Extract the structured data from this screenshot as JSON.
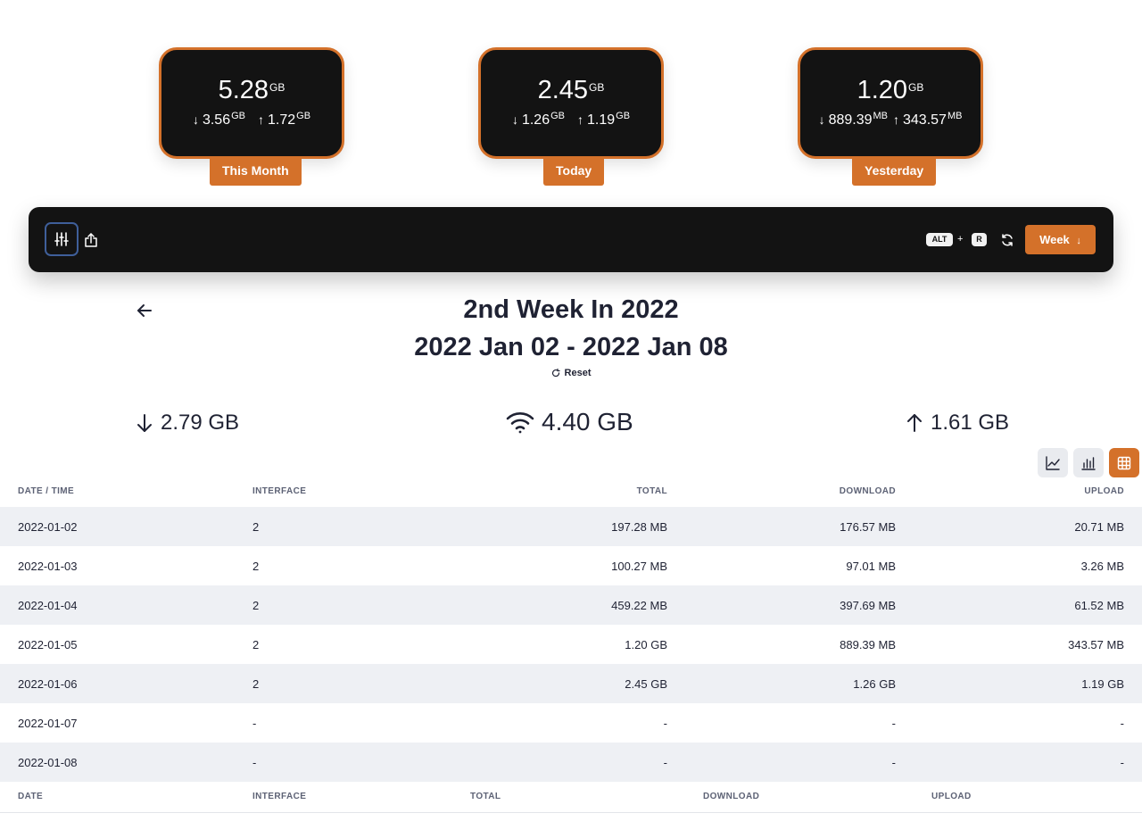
{
  "cards": [
    {
      "label": "This Month",
      "total": "5.28",
      "total_unit": "GB",
      "down": "3.56",
      "down_unit": "GB",
      "up": "1.72",
      "up_unit": "GB"
    },
    {
      "label": "Today",
      "total": "2.45",
      "total_unit": "GB",
      "down": "1.26",
      "down_unit": "GB",
      "up": "1.19",
      "up_unit": "GB"
    },
    {
      "label": "Yesterday",
      "total": "1.20",
      "total_unit": "GB",
      "down": "889.39",
      "down_unit": "MB",
      "up": "343.57",
      "up_unit": "MB"
    }
  ],
  "toolbar": {
    "shortcut_key1": "ALT",
    "shortcut_plus": "+",
    "shortcut_key2": "R",
    "period_button": "Week"
  },
  "heading": {
    "title": "2nd Week In 2022",
    "range": "2022 Jan 02 - 2022 Jan 08",
    "reset": "Reset"
  },
  "totals": {
    "download": "2.79 GB",
    "total": "4.40 GB",
    "upload": "1.61 GB"
  },
  "table": {
    "headers": [
      "DATE / TIME",
      "INTERFACE",
      "TOTAL",
      "DOWNLOAD",
      "UPLOAD"
    ],
    "footer": [
      "DATE",
      "INTERFACE",
      "TOTAL",
      "DOWNLOAD",
      "UPLOAD"
    ],
    "rows": [
      [
        "2022-01-02",
        "2",
        "197.28 MB",
        "176.57 MB",
        "20.71 MB"
      ],
      [
        "2022-01-03",
        "2",
        "100.27 MB",
        "97.01 MB",
        "3.26 MB"
      ],
      [
        "2022-01-04",
        "2",
        "459.22 MB",
        "397.69 MB",
        "61.52 MB"
      ],
      [
        "2022-01-05",
        "2",
        "1.20 GB",
        "889.39 MB",
        "343.57 MB"
      ],
      [
        "2022-01-06",
        "2",
        "2.45 GB",
        "1.26 GB",
        "1.19 GB"
      ],
      [
        "2022-01-07",
        "-",
        "-",
        "-",
        "-"
      ],
      [
        "2022-01-08",
        "-",
        "-",
        "-",
        "-"
      ]
    ]
  },
  "icons": {
    "filter": "sliders-icon",
    "export": "share-icon",
    "refresh": "refresh-icon",
    "back": "arrow-left-icon",
    "wifi": "wifi-icon",
    "line_chart": "line-chart-icon",
    "bar_chart": "bar-chart-icon",
    "table": "table-icon"
  },
  "colors": {
    "accent": "#d4712a",
    "dark": "#131313",
    "row_alt": "#eef0f4"
  }
}
